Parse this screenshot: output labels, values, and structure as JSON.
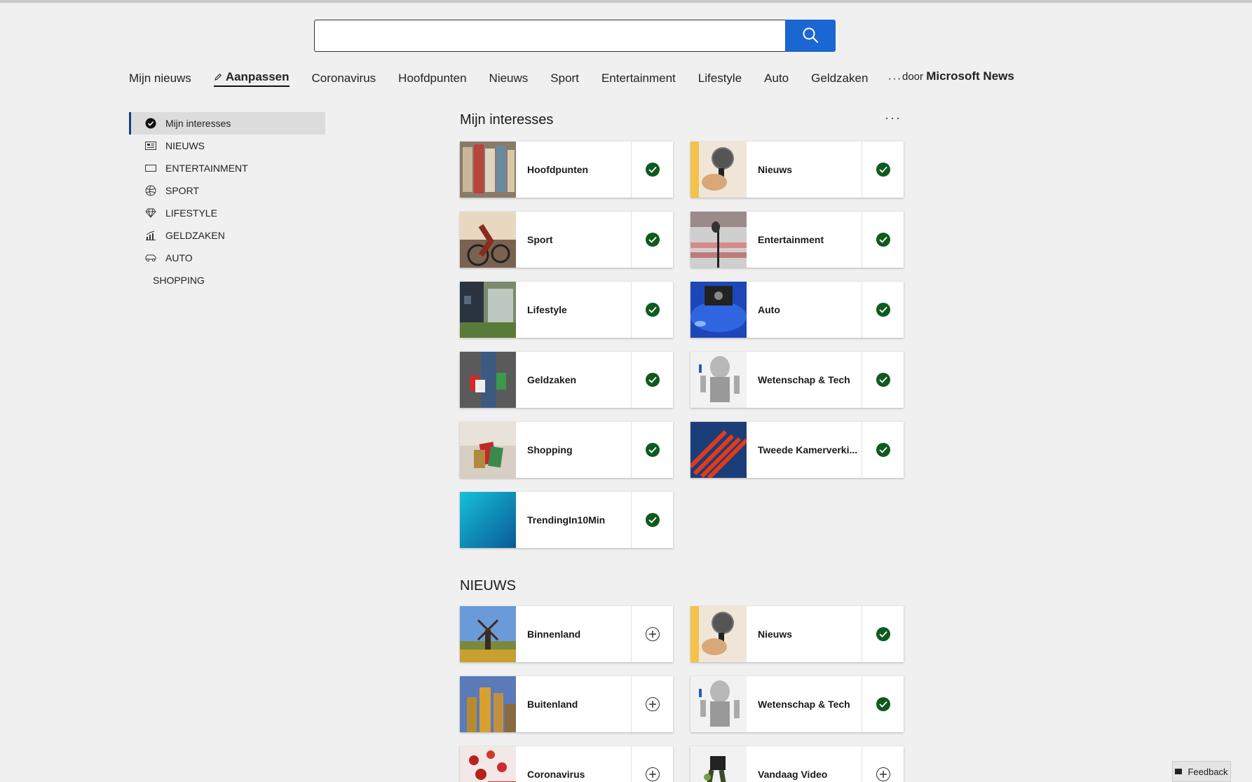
{
  "search": {
    "value": "",
    "placeholder": ""
  },
  "nav": {
    "items": [
      "Mijn nieuws",
      "Aanpassen",
      "Coronavirus",
      "Hoofdpunten",
      "Nieuws",
      "Sport",
      "Entertainment",
      "Lifestyle",
      "Auto",
      "Geldzaken"
    ],
    "active": "Aanpassen",
    "more": "···",
    "byline_prefix": "door",
    "byline_brand": "Microsoft News"
  },
  "sidebar": {
    "items": [
      {
        "label": "Mijn interesses",
        "icon": "check-circle-icon"
      },
      {
        "label": "NIEUWS",
        "icon": "newspaper-icon"
      },
      {
        "label": "ENTERTAINMENT",
        "icon": "ticket-icon"
      },
      {
        "label": "SPORT",
        "icon": "ball-icon"
      },
      {
        "label": "LIFESTYLE",
        "icon": "diamond-icon"
      },
      {
        "label": "GELDZAKEN",
        "icon": "chart-icon"
      },
      {
        "label": "AUTO",
        "icon": "car-icon"
      },
      {
        "label": "SHOPPING",
        "icon": ""
      }
    ]
  },
  "interests": {
    "title": "Mijn interesses",
    "more": "···",
    "cards": [
      {
        "label": "Hoofdpunten",
        "state": "selected"
      },
      {
        "label": "Nieuws",
        "state": "selected"
      },
      {
        "label": "Sport",
        "state": "selected"
      },
      {
        "label": "Entertainment",
        "state": "selected"
      },
      {
        "label": "Lifestyle",
        "state": "selected"
      },
      {
        "label": "Auto",
        "state": "selected"
      },
      {
        "label": "Geldzaken",
        "state": "selected"
      },
      {
        "label": "Wetenschap & Tech",
        "state": "selected"
      },
      {
        "label": "Shopping",
        "state": "selected"
      },
      {
        "label": "Tweede Kamerverki...",
        "state": "selected"
      },
      {
        "label": "TrendingIn10Min",
        "state": "selected"
      }
    ]
  },
  "nieuws": {
    "title": "NIEUWS",
    "cards": [
      {
        "label": "Binnenland",
        "state": "add"
      },
      {
        "label": "Nieuws",
        "state": "selected"
      },
      {
        "label": "Buitenland",
        "state": "add"
      },
      {
        "label": "Wetenschap & Tech",
        "state": "selected"
      },
      {
        "label": "Coronavirus",
        "state": "add"
      },
      {
        "label": "Vandaag Video",
        "state": "add"
      }
    ]
  },
  "feedback": {
    "label": "Feedback"
  },
  "colors": {
    "accent": "#1a66d2",
    "check": "#0f5a1e",
    "selected_bar": "#1a3a8a"
  }
}
